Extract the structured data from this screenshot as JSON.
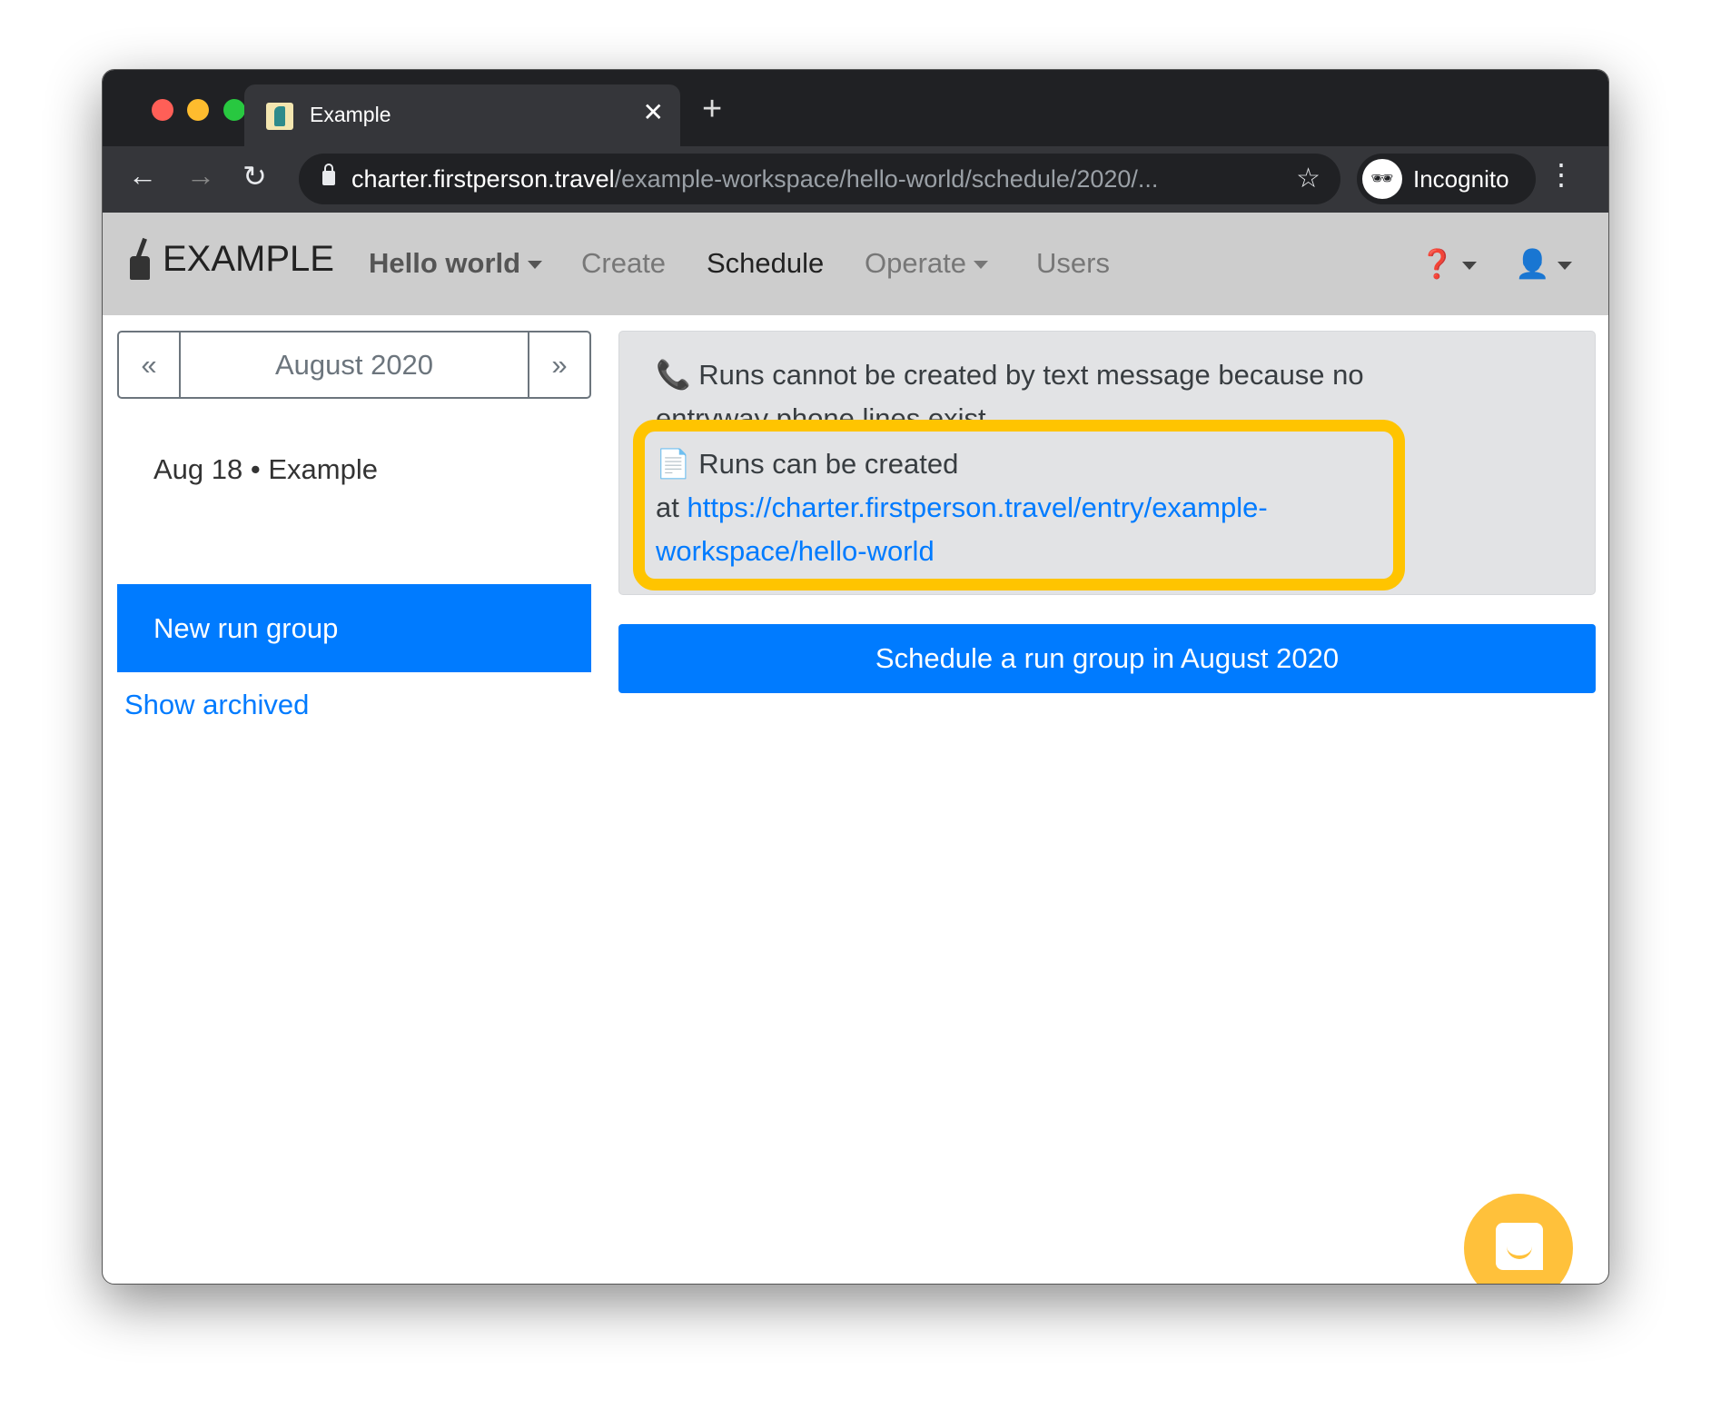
{
  "browser": {
    "tab_title": "Example",
    "url_host": "charter.firstperson.travel",
    "url_path": "/example-workspace/hello-world/schedule/2020/...",
    "profile": "Incognito"
  },
  "nav": {
    "brand": "EXAMPLE",
    "workspace": "Hello world",
    "items": [
      "Create",
      "Schedule",
      "Operate",
      "Users"
    ],
    "active": "Schedule"
  },
  "sidebar": {
    "prev": "«",
    "month": "August 2020",
    "next": "»",
    "entries": [
      {
        "date": "Aug 18",
        "sep": "•",
        "name": "Example"
      }
    ],
    "new_group": "New run group",
    "show_archived": "Show archived"
  },
  "alert": {
    "sms": "Runs cannot be created by text message because no entryway phone lines exist",
    "web_prefix": "Runs can be created",
    "web_at": "at",
    "web_link": "https://charter.firstperson.travel/entry/example-workspace/hello-world"
  },
  "schedule_button": "Schedule a run group in August 2020",
  "colors": {
    "primary": "#007bff",
    "highlight": "#ffc400",
    "chat": "#ffc13b"
  }
}
